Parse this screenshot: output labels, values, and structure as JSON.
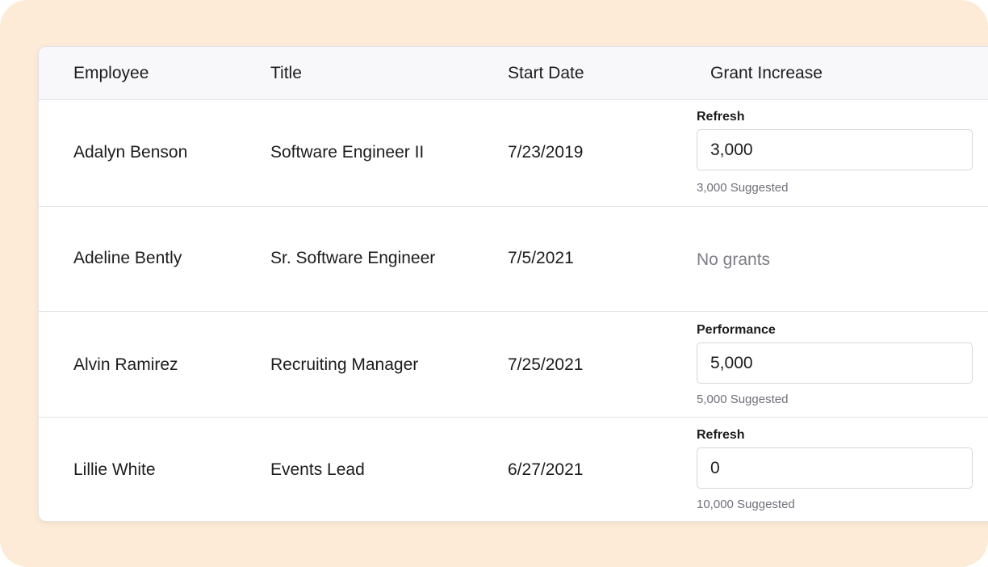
{
  "table": {
    "columns": [
      "Employee",
      "Title",
      "Start Date",
      "Grant Increase"
    ],
    "rows": [
      {
        "employee": "Adalyn Benson",
        "title": "Software Engineer II",
        "start_date": "7/23/2019",
        "grant_type": "Refresh",
        "grant_value": "3,000",
        "suggested": "3,000 Suggested"
      },
      {
        "employee": "Adeline Bently",
        "title": "Sr. Software Engineer",
        "start_date": "7/5/2021",
        "no_grants": "No grants"
      },
      {
        "employee": "Alvin Ramirez",
        "title": "Recruiting Manager",
        "start_date": "7/25/2021",
        "grant_type": "Performance",
        "grant_value": "5,000",
        "suggested": "5,000 Suggested"
      },
      {
        "employee": "Lillie White",
        "title": "Events Lead",
        "start_date": "6/27/2021",
        "grant_type": "Refresh",
        "grant_value": "0",
        "suggested": "10,000 Suggested"
      }
    ]
  },
  "colors": {
    "backdrop": "#fdebd7",
    "header_bg": "#f8f8fa",
    "border": "#e2e3e8",
    "text": "#1c1c1f",
    "muted": "#6f7078"
  }
}
